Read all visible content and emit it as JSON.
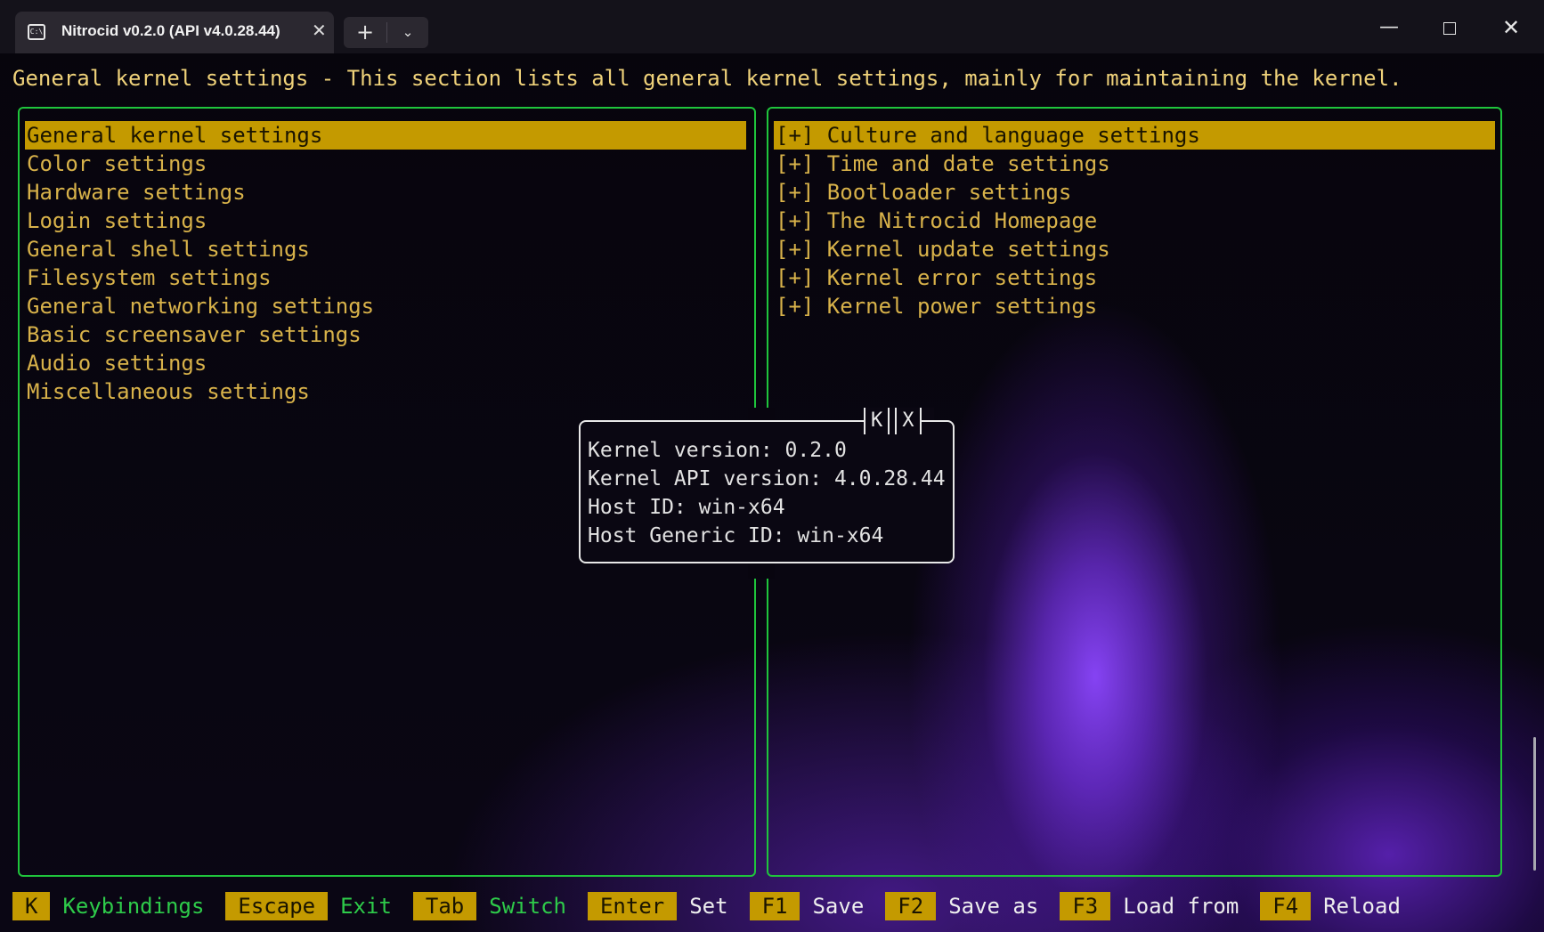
{
  "window": {
    "tab_title": "Nitrocid v0.2.0 (API v4.0.28.44)",
    "tab_icon_glyph": "C:\\",
    "tab_close_glyph": "✕",
    "new_tab_glyph": "+",
    "dropdown_glyph": "⌄",
    "minimize_glyph": "—",
    "close_glyph": "✕"
  },
  "heading": "General kernel settings - This section lists all general kernel settings, mainly for maintaining the kernel.",
  "left_pane": {
    "items": [
      {
        "label": "General kernel settings",
        "selected": true
      },
      {
        "label": "Color settings"
      },
      {
        "label": "Hardware settings"
      },
      {
        "label": "Login settings"
      },
      {
        "label": "General shell settings"
      },
      {
        "label": "Filesystem settings"
      },
      {
        "label": "General networking settings"
      },
      {
        "label": "Basic screensaver settings"
      },
      {
        "label": "Audio settings"
      },
      {
        "label": "Miscellaneous settings"
      }
    ]
  },
  "right_pane": {
    "items": [
      {
        "label": "[+] Culture and language settings",
        "selected": true
      },
      {
        "label": "[+] Time and date settings"
      },
      {
        "label": "[+] Bootloader settings"
      },
      {
        "label": "[+] The Nitrocid Homepage"
      },
      {
        "label": "[+] Kernel update settings"
      },
      {
        "label": "[+] Kernel error settings"
      },
      {
        "label": "[+] Kernel power settings"
      }
    ]
  },
  "info_dialog": {
    "buttons": [
      "K",
      "X"
    ],
    "lines": [
      "Kernel version: 0.2.0",
      "Kernel API version: 4.0.28.44",
      "Host ID: win-x64",
      "Host Generic ID: win-x64"
    ]
  },
  "keybindings": [
    {
      "key": "K",
      "label": "Keybindings",
      "style": "green"
    },
    {
      "key": "Escape",
      "label": "Exit",
      "style": "green"
    },
    {
      "key": "Tab",
      "label": "Switch",
      "style": "green"
    },
    {
      "key": "Enter",
      "label": "Set",
      "style": "light"
    },
    {
      "key": "F1",
      "label": "Save",
      "style": "light"
    },
    {
      "key": "F2",
      "label": "Save as",
      "style": "light"
    },
    {
      "key": "F3",
      "label": "Load from",
      "style": "light"
    },
    {
      "key": "F4",
      "label": "Reload",
      "style": "light"
    }
  ],
  "colors": {
    "accent": "#c49a00",
    "border_green": "#1fc53c",
    "text_yellow": "#d8b24a",
    "background": "#08050f",
    "glow_purple": "#8c46ff"
  }
}
